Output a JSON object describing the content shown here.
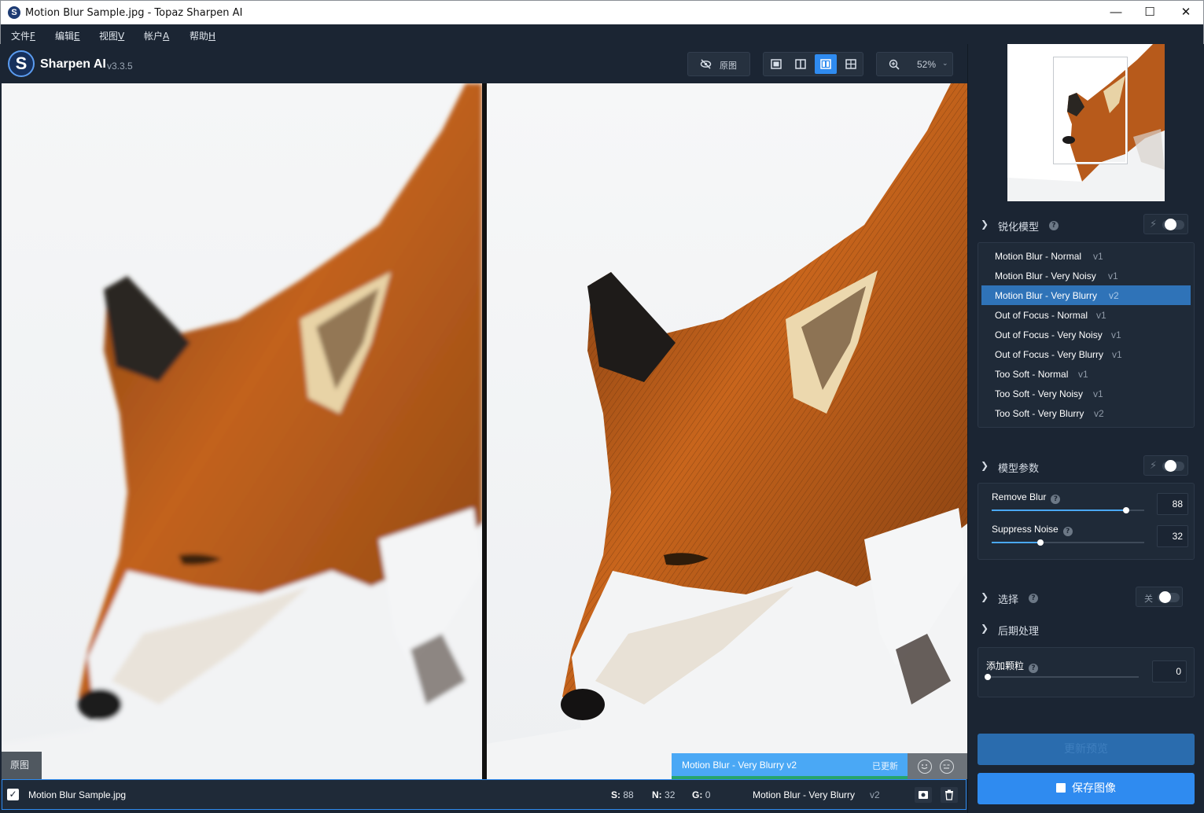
{
  "window": {
    "title": "Motion Blur Sample.jpg - Topaz Sharpen AI",
    "app_icon_letter": "S",
    "controls": {
      "minimize": "—",
      "maximize": "☐",
      "close": "✕"
    }
  },
  "menu": [
    {
      "label": "文件",
      "key": "F"
    },
    {
      "label": "编辑",
      "key": "E"
    },
    {
      "label": "视图",
      "key": "V"
    },
    {
      "label": "帐户",
      "key": "A"
    },
    {
      "label": "帮助",
      "key": "H"
    }
  ],
  "toolbar": {
    "logo_letter": "S",
    "brand": "Sharpen AI",
    "version": "v3.3.5",
    "original_toggle": {
      "label": "原图",
      "icon": "eye-slash-icon"
    },
    "view_modes": [
      {
        "id": "single",
        "icon": "single-view-icon",
        "active": false
      },
      {
        "id": "split",
        "icon": "split-view-icon",
        "active": false
      },
      {
        "id": "side-by-side",
        "icon": "side-by-side-view-icon",
        "active": true
      },
      {
        "id": "quad",
        "icon": "quad-view-icon",
        "active": false
      }
    ],
    "zoom": {
      "icon": "zoom-in-icon",
      "value": "52%"
    }
  },
  "preview": {
    "left_tag": "原图",
    "right_model": "Motion Blur - Very Blurry v2",
    "right_state": "已更新",
    "feedback_icons": [
      "smile-face-icon",
      "neutral-face-icon"
    ]
  },
  "filebar": {
    "checked": true,
    "filename": "Motion Blur Sample.jpg",
    "stats": [
      {
        "label": "S:",
        "value": "88"
      },
      {
        "label": "N:",
        "value": "32"
      },
      {
        "label": "G:",
        "value": "0"
      }
    ],
    "model": "Motion Blur - Very Blurry",
    "model_version": "v2",
    "actions": [
      "preview-icon",
      "trash-icon"
    ]
  },
  "sidebar": {
    "model_section": {
      "title": "锐化模型",
      "models": [
        {
          "name": "Motion Blur - Normal",
          "version": "v1",
          "selected": false
        },
        {
          "name": "Motion Blur - Very Noisy",
          "version": "v1",
          "selected": false
        },
        {
          "name": "Motion Blur - Very Blurry",
          "version": "v2",
          "selected": true
        },
        {
          "name": "Out of Focus - Normal",
          "version": "v1",
          "selected": false
        },
        {
          "name": "Out of Focus - Very Noisy",
          "version": "v1",
          "selected": false
        },
        {
          "name": "Out of Focus - Very Blurry",
          "version": "v1",
          "selected": false
        },
        {
          "name": "Too Soft - Normal",
          "version": "v1",
          "selected": false
        },
        {
          "name": "Too Soft - Very Noisy",
          "version": "v1",
          "selected": false
        },
        {
          "name": "Too Soft - Very Blurry",
          "version": "v2",
          "selected": false
        }
      ]
    },
    "params_section": {
      "title": "模型参数",
      "params": [
        {
          "label": "Remove Blur",
          "value": "88",
          "fraction": 0.88
        },
        {
          "label": "Suppress Noise",
          "value": "32",
          "fraction": 0.32
        }
      ]
    },
    "selection_section": {
      "title": "选择",
      "toggle_label": "关"
    },
    "post_section": {
      "title": "后期处理",
      "grain": {
        "label": "添加颗粒",
        "value": "0",
        "fraction": 0
      }
    },
    "update_button": "更新预览",
    "save_button": "保存图像"
  },
  "colors": {
    "accent": "#2f8bf0",
    "selected_row": "#2f73b8",
    "badge": "#4aa8f5",
    "background": "#1b2533"
  }
}
